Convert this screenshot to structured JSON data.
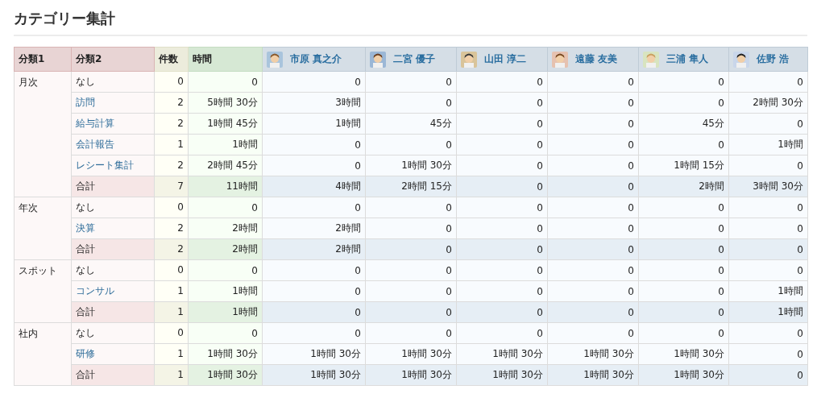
{
  "title": "カテゴリー集計",
  "columns": {
    "category1": "分類1",
    "category2": "分類2",
    "count": "件数",
    "time": "時間"
  },
  "people": [
    {
      "name": "市原 真之介"
    },
    {
      "name": "二宮 優子"
    },
    {
      "name": "山田 淳二"
    },
    {
      "name": "遠藤 友美"
    },
    {
      "name": "三浦 隼人"
    },
    {
      "name": "佐野 浩"
    }
  ],
  "groups": [
    {
      "name": "月次",
      "rows": [
        {
          "kind": "plain",
          "label": "なし",
          "count": "0",
          "time": "0",
          "values": [
            "0",
            "0",
            "0",
            "0",
            "0",
            "0"
          ]
        },
        {
          "kind": "link",
          "label": "訪問",
          "count": "2",
          "time": "5時間 30分",
          "values": [
            "3時間",
            "0",
            "0",
            "0",
            "0",
            "2時間 30分"
          ]
        },
        {
          "kind": "link",
          "label": "給与計算",
          "count": "2",
          "time": "1時間 45分",
          "values": [
            "1時間",
            "45分",
            "0",
            "0",
            "45分",
            "0"
          ]
        },
        {
          "kind": "link",
          "label": "会計報告",
          "count": "1",
          "time": "1時間",
          "values": [
            "0",
            "0",
            "0",
            "0",
            "0",
            "1時間"
          ]
        },
        {
          "kind": "link",
          "label": "レシート集計",
          "count": "2",
          "time": "2時間 45分",
          "values": [
            "0",
            "1時間 30分",
            "0",
            "0",
            "1時間 15分",
            "0"
          ]
        },
        {
          "kind": "total",
          "label": "合計",
          "count": "7",
          "time": "11時間",
          "values": [
            "4時間",
            "2時間 15分",
            "0",
            "0",
            "2時間",
            "3時間 30分"
          ]
        }
      ]
    },
    {
      "name": "年次",
      "rows": [
        {
          "kind": "plain",
          "label": "なし",
          "count": "0",
          "time": "0",
          "values": [
            "0",
            "0",
            "0",
            "0",
            "0",
            "0"
          ]
        },
        {
          "kind": "link",
          "label": "決算",
          "count": "2",
          "time": "2時間",
          "values": [
            "2時間",
            "0",
            "0",
            "0",
            "0",
            "0"
          ]
        },
        {
          "kind": "total",
          "label": "合計",
          "count": "2",
          "time": "2時間",
          "values": [
            "2時間",
            "0",
            "0",
            "0",
            "0",
            "0"
          ]
        }
      ]
    },
    {
      "name": "スポット",
      "rows": [
        {
          "kind": "plain",
          "label": "なし",
          "count": "0",
          "time": "0",
          "values": [
            "0",
            "0",
            "0",
            "0",
            "0",
            "0"
          ]
        },
        {
          "kind": "link",
          "label": "コンサル",
          "count": "1",
          "time": "1時間",
          "values": [
            "0",
            "0",
            "0",
            "0",
            "0",
            "1時間"
          ]
        },
        {
          "kind": "total",
          "label": "合計",
          "count": "1",
          "time": "1時間",
          "values": [
            "0",
            "0",
            "0",
            "0",
            "0",
            "1時間"
          ]
        }
      ]
    },
    {
      "name": "社内",
      "rows": [
        {
          "kind": "plain",
          "label": "なし",
          "count": "0",
          "time": "0",
          "values": [
            "0",
            "0",
            "0",
            "0",
            "0",
            "0"
          ]
        },
        {
          "kind": "link",
          "label": "研修",
          "count": "1",
          "time": "1時間 30分",
          "values": [
            "1時間 30分",
            "1時間 30分",
            "1時間 30分",
            "1時間 30分",
            "1時間 30分",
            "0"
          ]
        },
        {
          "kind": "total",
          "label": "合計",
          "count": "1",
          "time": "1時間 30分",
          "values": [
            "1時間 30分",
            "1時間 30分",
            "1時間 30分",
            "1時間 30分",
            "1時間 30分",
            "0"
          ]
        }
      ]
    }
  ]
}
